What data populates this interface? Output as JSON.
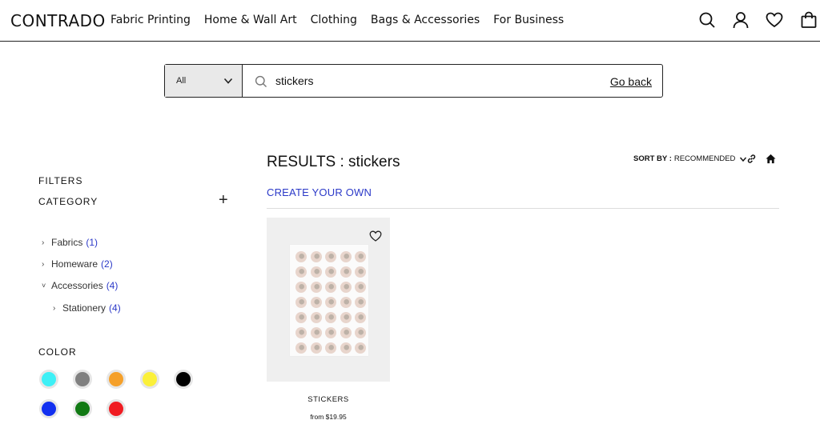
{
  "header": {
    "logo": "CONTRADO",
    "nav": [
      "Fabric Printing",
      "Home & Wall Art",
      "Clothing",
      "Bags & Accessories",
      "For Business"
    ],
    "icons": [
      "search-icon",
      "account-icon",
      "wishlist-heart-icon",
      "cart-bag-icon"
    ]
  },
  "search": {
    "scope": "All",
    "value": "stickers",
    "go_back": "Go back"
  },
  "filters": {
    "title": "FILTERS",
    "category_title": "CATEGORY",
    "categories": [
      {
        "label": "Fabrics",
        "count": "(1)"
      },
      {
        "label": "Homeware",
        "count": "(2)"
      },
      {
        "label": "Accessories",
        "count": "(4)"
      },
      {
        "label": "Stationery",
        "count": "(4)"
      }
    ],
    "color_title": "COLOR",
    "colors": [
      "#3ef0f6",
      "#808080",
      "#f5a02a",
      "#fbf03a",
      "#000000",
      "#1230f0",
      "#127a14",
      "#f01c22"
    ]
  },
  "results": {
    "title": "RESULTS : stickers",
    "create_own": "CREATE YOUR OWN",
    "sort_label": "SORT BY :",
    "sort_value": "RECOMMENDED",
    "products": [
      {
        "name": "STICKERS",
        "price": "from $19.95"
      }
    ]
  }
}
